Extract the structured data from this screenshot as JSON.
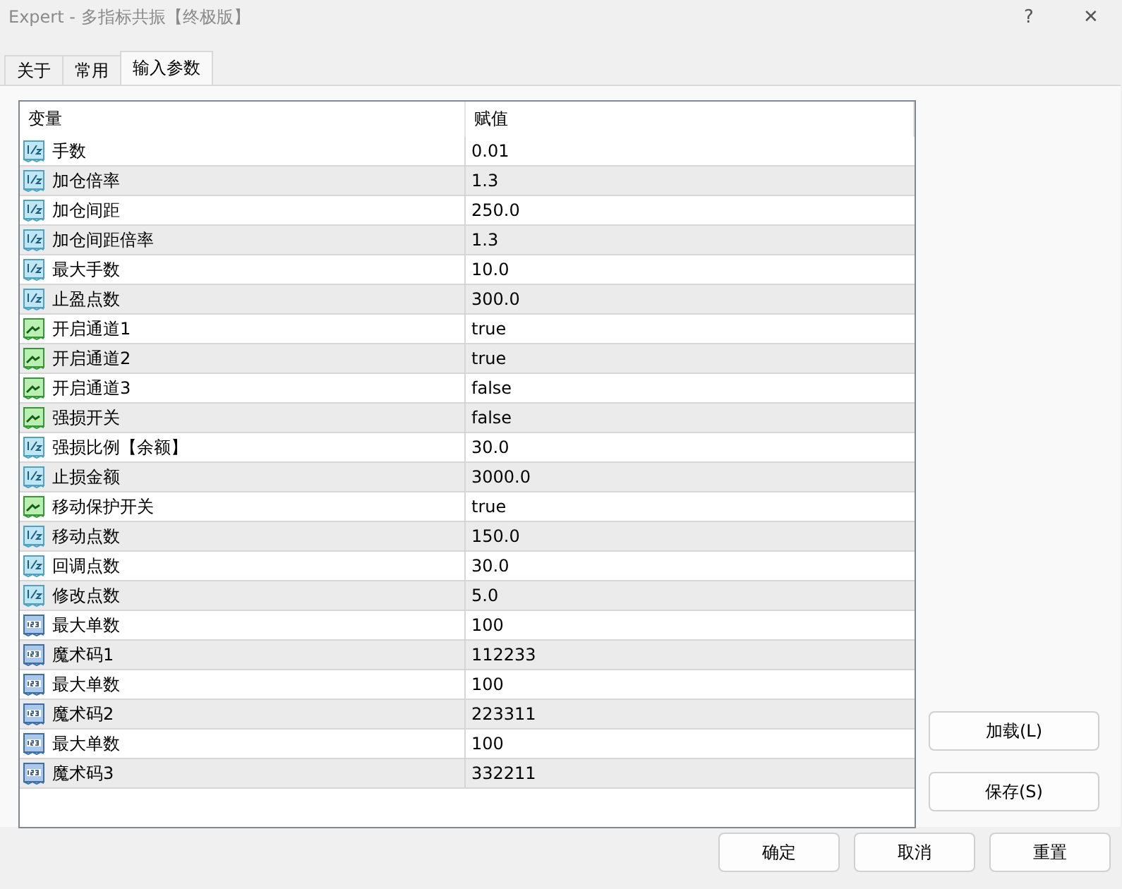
{
  "window": {
    "title": "Expert - 多指标共振【终极版】",
    "help": "?",
    "close": "✕"
  },
  "tabs": [
    {
      "label": "关于",
      "selected": false
    },
    {
      "label": "常用",
      "selected": false
    },
    {
      "label": "输入参数",
      "selected": true
    }
  ],
  "table": {
    "columns": [
      "变量",
      "赋值"
    ],
    "rows": [
      {
        "kind": "double",
        "name": "手数",
        "value": "0.01"
      },
      {
        "kind": "double",
        "name": "加仓倍率",
        "value": "1.3"
      },
      {
        "kind": "double",
        "name": "加仓间距",
        "value": "250.0"
      },
      {
        "kind": "double",
        "name": "加仓间距倍率",
        "value": "1.3"
      },
      {
        "kind": "double",
        "name": "最大手数",
        "value": "10.0"
      },
      {
        "kind": "double",
        "name": "止盈点数",
        "value": "300.0"
      },
      {
        "kind": "bool",
        "name": "开启通道1",
        "value": "true"
      },
      {
        "kind": "bool",
        "name": "开启通道2",
        "value": "true"
      },
      {
        "kind": "bool",
        "name": "开启通道3",
        "value": "false"
      },
      {
        "kind": "bool",
        "name": "强损开关",
        "value": "false"
      },
      {
        "kind": "double",
        "name": "强损比例【余额】",
        "value": "30.0"
      },
      {
        "kind": "double",
        "name": "止损金额",
        "value": "3000.0"
      },
      {
        "kind": "bool",
        "name": "移动保护开关",
        "value": "true"
      },
      {
        "kind": "double",
        "name": "移动点数",
        "value": "150.0"
      },
      {
        "kind": "double",
        "name": "回调点数",
        "value": "30.0"
      },
      {
        "kind": "double",
        "name": "修改点数",
        "value": "5.0"
      },
      {
        "kind": "int",
        "name": "最大单数",
        "value": "100"
      },
      {
        "kind": "int",
        "name": "魔术码1",
        "value": "112233"
      },
      {
        "kind": "int",
        "name": "最大单数",
        "value": "100"
      },
      {
        "kind": "int",
        "name": "魔术码2",
        "value": "223311"
      },
      {
        "kind": "int",
        "name": "最大单数",
        "value": "100"
      },
      {
        "kind": "int",
        "name": "魔术码3",
        "value": "332211"
      }
    ]
  },
  "side_buttons": [
    "加载(L)",
    "保存(S)"
  ],
  "buttons": [
    "确定",
    "取消",
    "重置"
  ]
}
